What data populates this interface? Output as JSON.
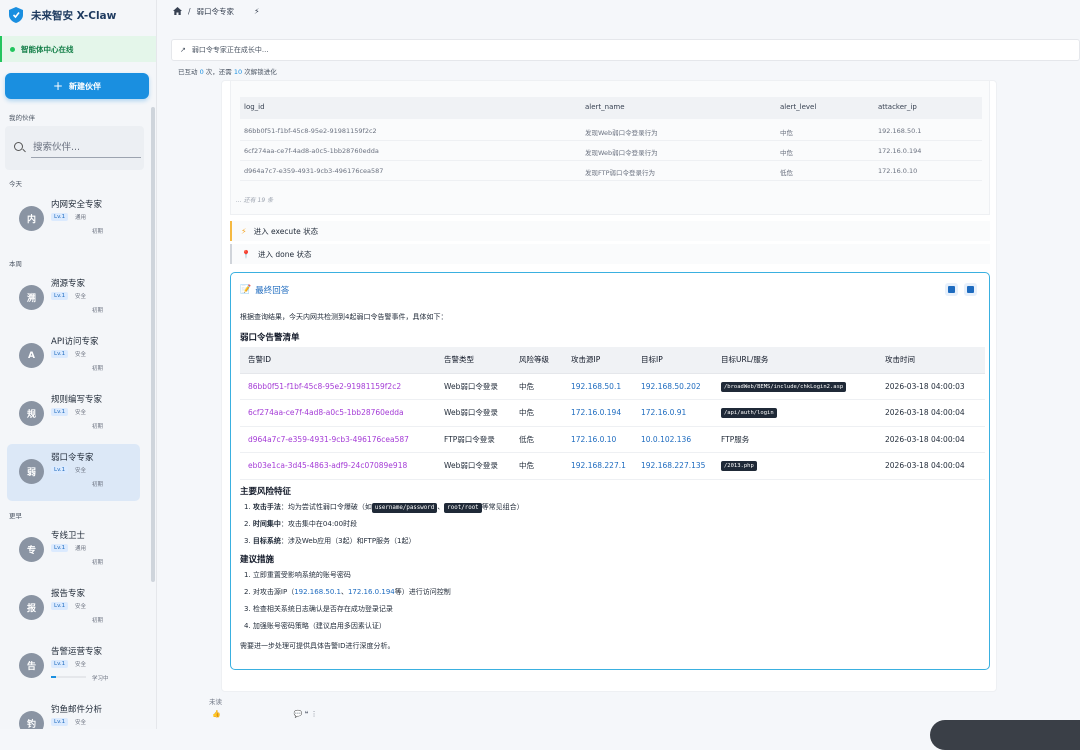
{
  "app": {
    "title": "未来智安 X-Claw",
    "status": "智能体中心在线",
    "new_button": "新建伙伴"
  },
  "sidebar": {
    "section_partners": "我的伙伴",
    "search_placeholder": "搜索伙伴...",
    "groups": [
      {
        "label": "今天"
      },
      {
        "label": "本周"
      },
      {
        "label": "更早"
      }
    ],
    "items": [
      {
        "avatar": "内",
        "name": "内网安全专家",
        "level": "Lv.1",
        "type": "通用",
        "state": "初期"
      },
      {
        "avatar": "溯",
        "name": "溯源专家",
        "level": "Lv.1",
        "type": "安全",
        "state": "初期"
      },
      {
        "avatar": "A",
        "name": "API访问专家",
        "level": "Lv.1",
        "type": "安全",
        "state": "初期"
      },
      {
        "avatar": "规",
        "name": "规则编写专家",
        "level": "Lv.1",
        "type": "安全",
        "state": "初期"
      },
      {
        "avatar": "弱",
        "name": "弱口令专家",
        "level": "Lv.1",
        "type": "安全",
        "state": "初期"
      },
      {
        "avatar": "专",
        "name": "专线卫士",
        "level": "Lv.1",
        "type": "通用",
        "state": "初期"
      },
      {
        "avatar": "报",
        "name": "报告专家",
        "level": "Lv.1",
        "type": "安全",
        "state": "初期"
      },
      {
        "avatar": "告",
        "name": "告警运营专家",
        "level": "Lv.1",
        "type": "安全",
        "state": "学习中",
        "progress": 0.15
      },
      {
        "avatar": "钓",
        "name": "钓鱼邮件分析",
        "level": "Lv.1",
        "type": "安全",
        "state": ""
      }
    ]
  },
  "breadcrumb": {
    "sep": "/",
    "current": "弱口令专家"
  },
  "banner": {
    "text": "弱口令专家正在成长中..."
  },
  "counter": {
    "p1": "已互动",
    "interacted": "0",
    "p2": "次，还需",
    "remaining": "10",
    "p3": "次解锁进化"
  },
  "prev_table": {
    "headers": [
      "log_id",
      "alert_name",
      "alert_level",
      "attacker_ip"
    ],
    "rows": [
      [
        "86bb0f51-f1bf-45c8-95e2-91981159f2c2",
        "发现Web弱口令登录行为",
        "中危",
        "192.168.50.1"
      ],
      [
        "6cf274aa-ce7f-4ad8-a0c5-1bb28760edda",
        "发现Web弱口令登录行为",
        "中危",
        "172.16.0.194"
      ],
      [
        "d964a7c7-e359-4931-9cb3-496176cea587",
        "发现FTP弱口令登录行为",
        "低危",
        "172.16.0.10"
      ]
    ],
    "more": "... 还有 19 条"
  },
  "states": {
    "execute": "进入 execute 状态",
    "done": "进入 done 状态"
  },
  "final": {
    "title": "最终回答",
    "intro": "根据查询结果，今天内网共检测到4起弱口令告警事件，具体如下：",
    "table_title": "弱口令告警清单",
    "headers": [
      "告警ID",
      "告警类型",
      "风险等级",
      "攻击源IP",
      "目标IP",
      "目标URL/服务",
      "攻击时间"
    ],
    "rows": [
      {
        "id": "86bb0f51-f1bf-45c8-95e2-91981159f2c2",
        "type": "Web弱口令登录",
        "risk": "中危",
        "src": "192.168.50.1",
        "dst": "192.168.50.202",
        "url": "/broadWeb/BEMS/include/chkLogin2.asp",
        "time": "2026-03-18 04:00:03"
      },
      {
        "id": "6cf274aa-ce7f-4ad8-a0c5-1bb28760edda",
        "type": "Web弱口令登录",
        "risk": "中危",
        "src": "172.16.0.194",
        "dst": "172.16.0.91",
        "url": "/api/auth/login",
        "time": "2026-03-18 04:00:04"
      },
      {
        "id": "d964a7c7-e359-4931-9cb3-496176cea587",
        "type": "FTP弱口令登录",
        "risk": "低危",
        "src": "172.16.0.10",
        "dst": "10.0.102.136",
        "url": "FTP服务",
        "time": "2026-03-18 04:00:04"
      },
      {
        "id": "eb03e1ca-3d45-4863-adf9-24c07089e918",
        "type": "Web弱口令登录",
        "risk": "中危",
        "src": "192.168.227.1",
        "dst": "192.168.227.135",
        "url": "/2013.php",
        "time": "2026-03-18 04:00:04"
      }
    ],
    "risk_title": "主要风险特征",
    "risk1_n": "1.",
    "risk1_b": "攻击手法",
    "risk1_a": "：均为尝试性弱口令爆破（如",
    "risk1_c1": "username/password",
    "risk1_sep": "、",
    "risk1_c2": "root/root",
    "risk1_z": "等常见组合）",
    "risk2_n": "2.",
    "risk2_b": "时间集中",
    "risk2_a": "：攻击集中在04:00时段",
    "risk3_n": "3.",
    "risk3_b": "目标系统",
    "risk3_a": "：涉及Web应用（3起）和FTP服务（1起）",
    "sugg_title": "建议措施",
    "s1": "1. 立即重置受影响系统的账号密码",
    "s2_a": "2. 对攻击源IP（",
    "s2_ip1": "192.168.50.1",
    "s2_sep": "、",
    "s2_ip2": "172.16.0.194",
    "s2_z": "等）进行访问控制",
    "s3": "3. 检查相关系统日志确认是否存在成功登录记录",
    "s4": "4. 加强账号密码策略（建议启用多因素认证）",
    "closing": "需要进一步处理可提供具体告警ID进行深度分析。"
  },
  "footer": {
    "label": "未读"
  },
  "colors": {
    "accent": "#1a8fe0",
    "status_green": "#22c55e",
    "id_purple": "#a43bd6",
    "ip_blue": "#1e6bbf",
    "final_border": "#3ab0e0"
  }
}
